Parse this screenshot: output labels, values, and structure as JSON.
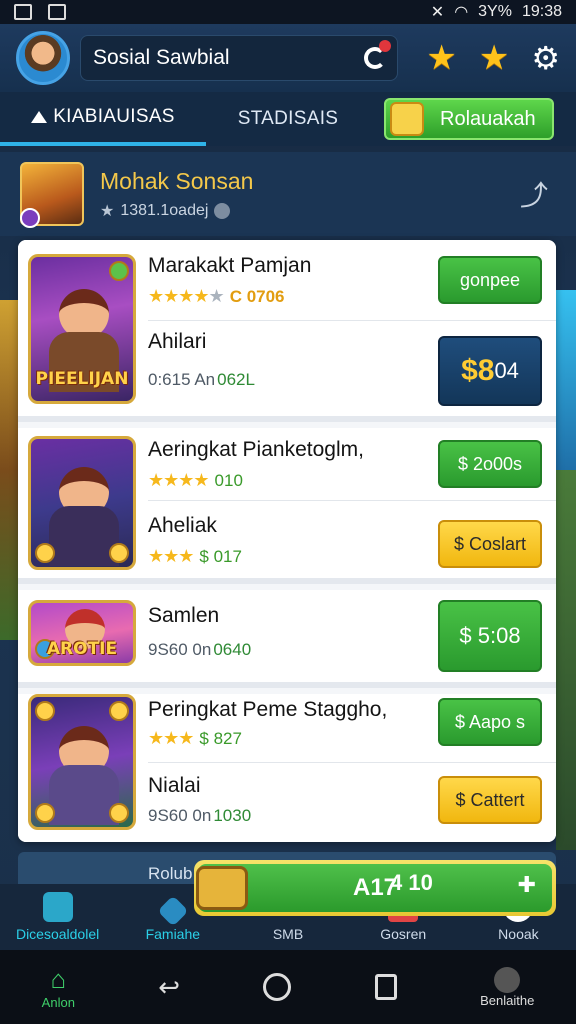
{
  "status_bar": {
    "time": "19:38",
    "battery": "3Y%"
  },
  "header": {
    "search_value": "Sosial Sawbial",
    "search_placeholder": "Sosial Sawbial"
  },
  "tabs": [
    {
      "label": "KIABIAUISAS",
      "active": true
    },
    {
      "label": "STADISAIS",
      "active": false
    }
  ],
  "promo_button": {
    "label": "Rolauakah"
  },
  "profile": {
    "name": "Mohak Sonsan",
    "subtitle": "1381.1oadej"
  },
  "cards": [
    {
      "art_label": "PIEELIJAN",
      "title": "Marakakt Pamjan",
      "rating_value": "C 0706",
      "button": "gonpee",
      "subtitle": "Ahilari",
      "meta_prefix": "0:615 An",
      "meta_value": "062L",
      "price_button": {
        "symbol": "$8",
        "amount": "04"
      }
    },
    {
      "art_label": "",
      "title": "Aeringkat Pianketoglm,",
      "rating_value": "010",
      "button": "$ 2o00s",
      "subtitle": "Aheliak",
      "rating2_value": "$ 017",
      "action_button": "$ Coslart"
    },
    {
      "art_label": "AROTIE",
      "title": "Samlen",
      "meta_prefix": "9S60 0n",
      "meta_value": "0640",
      "price_button": "$ 5:08"
    },
    {
      "art_label": "",
      "title": "Peringkat Peme Staggho,",
      "rating_value": "$ 827",
      "button": "$ Aapo s",
      "subtitle": "Nialai",
      "meta_prefix": "9S60 0n",
      "meta_value": "1030",
      "action_button": "$ Cattert"
    }
  ],
  "sub_strip": {
    "label": "Rolub"
  },
  "bonus_bar": {
    "left_value": "A17",
    "right_value": "4 10"
  },
  "bottom_nav": [
    {
      "label": "Dicesoaldolel"
    },
    {
      "label": "Famiahe"
    },
    {
      "label": "SMB"
    },
    {
      "label": "Gosren"
    },
    {
      "label": "Nooak"
    }
  ],
  "android_nav": {
    "home_label": "Anlon",
    "right_label": "Benlaithe"
  },
  "colors": {
    "accent_green": "#2e9f2a",
    "accent_blue": "#2fb3e8",
    "star_gold": "#ffc21a",
    "header_bg": "#1e3a5e"
  }
}
